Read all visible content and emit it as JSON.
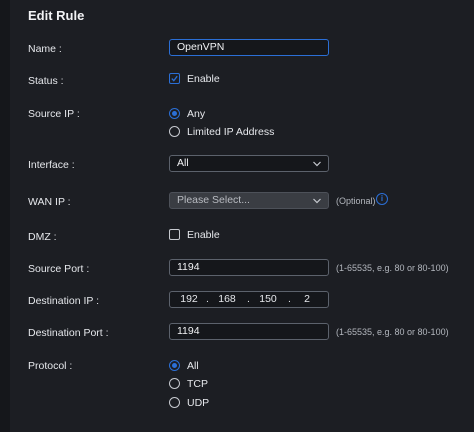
{
  "title": "Edit Rule",
  "fields": {
    "name": {
      "label": "Name :",
      "value": "OpenVPN"
    },
    "status": {
      "label": "Status :",
      "option": "Enable",
      "checked": true
    },
    "source_ip": {
      "label": "Source IP :",
      "options": [
        "Any",
        "Limited IP Address"
      ],
      "selected": "Any"
    },
    "interface": {
      "label": "Interface :",
      "value": "All"
    },
    "wan_ip": {
      "label": "WAN IP :",
      "placeholder": "Please Select...",
      "hint": "(Optional)"
    },
    "dmz": {
      "label": "DMZ :",
      "option": "Enable",
      "checked": false
    },
    "source_port": {
      "label": "Source Port :",
      "value": "1194",
      "hint": "(1-65535, e.g. 80 or 80-100)"
    },
    "destination_ip": {
      "label": "Destination IP :",
      "octets": [
        "192",
        "168",
        "150",
        "2"
      ],
      "dot": "."
    },
    "destination_port": {
      "label": "Destination Port :",
      "value": "1194",
      "hint": "(1-65535, e.g. 80 or 80-100)"
    },
    "protocol": {
      "label": "Protocol :",
      "options": [
        "All",
        "TCP",
        "UDP"
      ],
      "selected": "All"
    }
  },
  "colors": {
    "accent": "#2b6fd6",
    "panel": "#1c1e23",
    "input_bg": "#15171b"
  },
  "icons": [
    "check-icon",
    "chevron-down-icon",
    "info-icon"
  ]
}
